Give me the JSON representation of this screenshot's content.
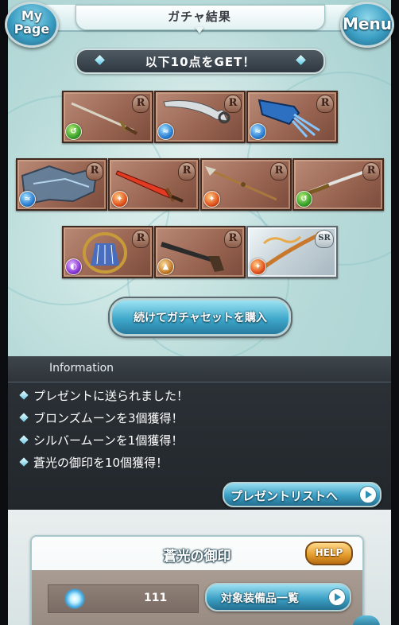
{
  "header": {
    "title": "ガチャ結果",
    "mypage_label": "My\nPage",
    "menu_label": "Menu"
  },
  "get_banner": "以下10点をGET！",
  "items": [
    {
      "rarity": "R",
      "element": "wind",
      "weapon": "sword"
    },
    {
      "rarity": "R",
      "element": "water",
      "weapon": "scimitar"
    },
    {
      "rarity": "R",
      "element": "water",
      "weapon": "gauntlet"
    },
    {
      "rarity": "R",
      "element": "water",
      "weapon": "dragon"
    },
    {
      "rarity": "R",
      "element": "fire",
      "weapon": "red-sword"
    },
    {
      "rarity": "R",
      "element": "fire",
      "weapon": "spear"
    },
    {
      "rarity": "R",
      "element": "wind",
      "weapon": "katana"
    },
    {
      "rarity": "R",
      "element": "dark",
      "weapon": "harp"
    },
    {
      "rarity": "R",
      "element": "earth",
      "weapon": "gun"
    },
    {
      "rarity": "SR",
      "element": "fire",
      "weapon": "staff"
    }
  ],
  "continue_button": "続けてガチャセットを購入",
  "information": {
    "title": "Information",
    "lines": [
      "プレゼントに送られました！",
      "ブロンズムーンを3個獲得！",
      "シルバームーンを1個獲得！",
      "蒼光の御印を10個獲得！"
    ],
    "present_button": "プレゼントリストへ"
  },
  "seal_panel": {
    "title": "蒼光の御印",
    "help_label": "HELP",
    "count": "111",
    "list_button": "対象装備品一覧"
  },
  "colors": {
    "accent_blue": "#3fa8cb",
    "card_bronze": "#9a6653",
    "help_orange": "#e29b2a"
  }
}
